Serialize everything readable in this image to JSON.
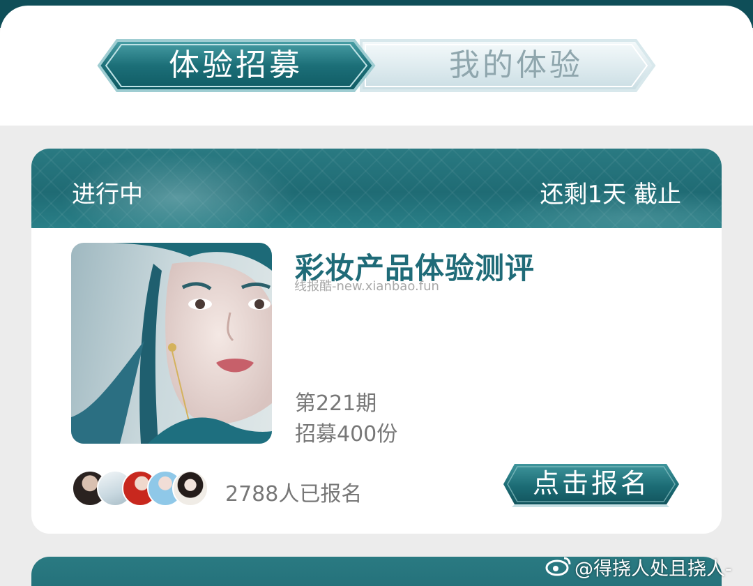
{
  "tabs": [
    {
      "label": "体验招募",
      "active": true
    },
    {
      "label": "我的体验",
      "active": false
    }
  ],
  "card": {
    "status": "进行中",
    "deadline": "还剩1天 截止",
    "title": "彩妆产品体验测评",
    "watermark": "线报酷-new.xianbao.fun",
    "issue": "第221期",
    "quota": "招募400份",
    "signups": "2788人已报名",
    "button_label": "点击报名"
  },
  "watermark_handle": "@得挠人处且挠人-",
  "colors": {
    "accent": "#1f6b78",
    "header_teal": "#1f6b74",
    "background": "#ececec"
  }
}
